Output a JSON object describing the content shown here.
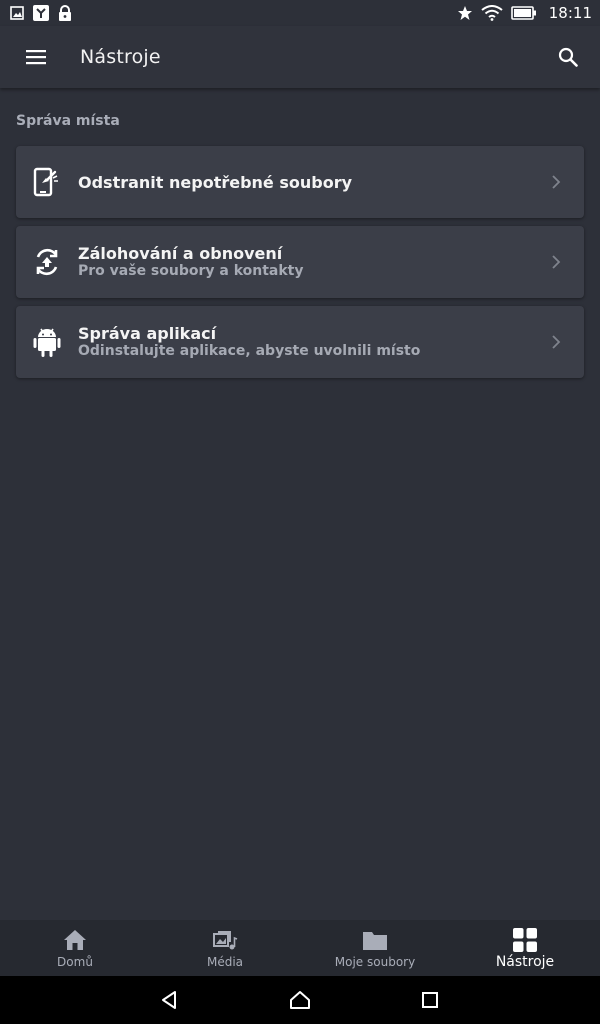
{
  "status_bar": {
    "time": "18:11",
    "icons_left": [
      "image-icon",
      "app-icon",
      "lock-icon"
    ],
    "icons_right": [
      "star-icon",
      "wifi-icon",
      "battery-icon"
    ]
  },
  "app_bar": {
    "title": "Nástroje",
    "menu_icon": "menu-icon",
    "search_icon": "search-icon"
  },
  "section": {
    "title": "Správa místa"
  },
  "cards": [
    {
      "title": "Odstranit nepotřebné soubory",
      "subtitle": "",
      "icon": "phone-clean-icon"
    },
    {
      "title": "Zálohování a obnovení",
      "subtitle": "Pro vaše soubory a kontakty",
      "icon": "backup-icon"
    },
    {
      "title": "Správa aplikací",
      "subtitle": "Odinstalujte aplikace, abyste uvolnili místo",
      "icon": "android-icon"
    }
  ],
  "bottom_nav": {
    "items": [
      {
        "label": "Domů",
        "icon": "home-icon",
        "active": false
      },
      {
        "label": "Média",
        "icon": "media-icon",
        "active": false
      },
      {
        "label": "Moje soubory",
        "icon": "folder-icon",
        "active": false
      },
      {
        "label": "Nástroje",
        "icon": "grid-icon",
        "active": true
      }
    ]
  },
  "system_nav": [
    "back-icon",
    "home-icon",
    "recents-icon"
  ],
  "colors": {
    "background": "#2d3039",
    "card": "#3b3e48",
    "bottom_nav": "#262930",
    "muted_text": "#a9adb8"
  }
}
